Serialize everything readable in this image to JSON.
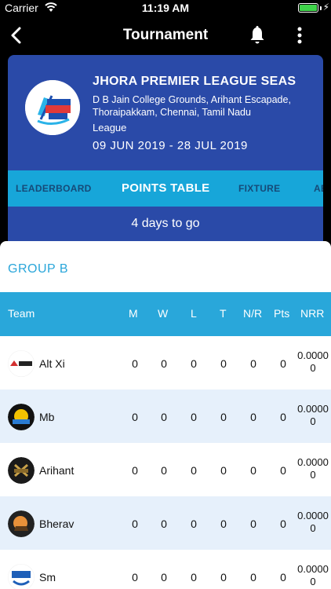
{
  "status_bar": {
    "carrier": "Carrier",
    "time": "11:19 AM",
    "battery_percent": 100
  },
  "nav": {
    "title": "Tournament"
  },
  "tournament": {
    "name": "JHORA PREMIER LEAGUE SEAS",
    "address": "D B Jain College Grounds, Arihant Escapade, Thoraipakkam, Chennai, Tamil Nadu",
    "type": "League",
    "dates": "09 JUN 2019 - 28 JUL 2019",
    "countdown": "4 days to go"
  },
  "tabs": [
    {
      "label": "LEADERBOARD",
      "active": false
    },
    {
      "label": "POINTS TABLE",
      "active": true
    },
    {
      "label": "FIXTURE",
      "active": false
    },
    {
      "label": "AB",
      "active": false
    }
  ],
  "group": {
    "title": "GROUP B"
  },
  "table": {
    "headers": {
      "team": "Team",
      "m": "M",
      "w": "W",
      "l": "L",
      "t": "T",
      "nr": "N/R",
      "pts": "Pts",
      "nrr": "NRR"
    },
    "rows": [
      {
        "team": "Alt Xi",
        "m": "0",
        "w": "0",
        "l": "0",
        "t": "0",
        "nr": "0",
        "pts": "0",
        "nrr": "0.00000"
      },
      {
        "team": "Mb",
        "m": "0",
        "w": "0",
        "l": "0",
        "t": "0",
        "nr": "0",
        "pts": "0",
        "nrr": "0.00000"
      },
      {
        "team": "Arihant",
        "m": "0",
        "w": "0",
        "l": "0",
        "t": "0",
        "nr": "0",
        "pts": "0",
        "nrr": "0.00000"
      },
      {
        "team": "Bherav",
        "m": "0",
        "w": "0",
        "l": "0",
        "t": "0",
        "nr": "0",
        "pts": "0",
        "nrr": "0.00000"
      },
      {
        "team": "Sm",
        "m": "0",
        "w": "0",
        "l": "0",
        "t": "0",
        "nr": "0",
        "pts": "0",
        "nrr": "0.00000"
      }
    ]
  },
  "colors": {
    "card": "#2a4aa8",
    "accent": "#29a7da",
    "row_alt": "#e6f0fb",
    "battery": "#3fd34a"
  }
}
